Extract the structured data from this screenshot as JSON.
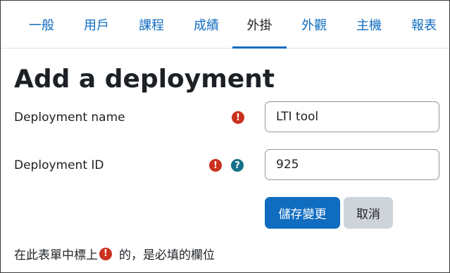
{
  "tabs": [
    {
      "label": "一般"
    },
    {
      "label": "用戶"
    },
    {
      "label": "課程"
    },
    {
      "label": "成績"
    },
    {
      "label": "外掛",
      "active": true
    },
    {
      "label": "外觀"
    },
    {
      "label": "主機"
    },
    {
      "label": "報表"
    }
  ],
  "page": {
    "title": "Add a deployment"
  },
  "form": {
    "deployment_name": {
      "label": "Deployment name",
      "value": "LTI tool",
      "required_icon": "exclamation-circle-icon"
    },
    "deployment_id": {
      "label": "Deployment ID",
      "value": "925",
      "required_icon": "exclamation-circle-icon",
      "help_icon": "question-circle-icon"
    },
    "save_label": "儲存變更",
    "cancel_label": "取消"
  },
  "footnote": {
    "prefix": "在此表單中標上",
    "suffix": "的，是必填的欄位"
  },
  "colors": {
    "accent": "#0f6cbf",
    "required": "#ca3120",
    "help": "#15708a",
    "text": "#1d2125",
    "secondary_button": "#ced4da"
  }
}
